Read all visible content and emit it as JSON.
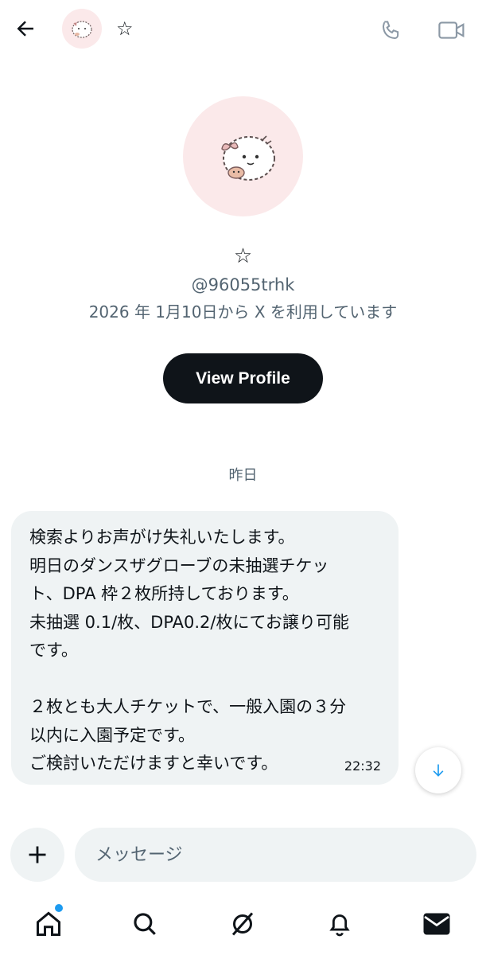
{
  "header": {
    "name": "☆",
    "back_icon": "arrow-left-icon",
    "call_icon": "phone-icon",
    "video_icon": "video-camera-icon"
  },
  "profile": {
    "name": "☆",
    "handle": "@96055trhk",
    "joined": "2026 年 1月10日から X を利用しています",
    "view_profile_label": "View Profile"
  },
  "conversation": {
    "date_label": "昨日",
    "messages": [
      {
        "text": "検索よりお声がけ失礼いたします。\n明日のダンスザグローブの未抽選チケッ\nト、DPA 枠２枚所持しております。\n未抽選 0.1/枚、DPA0.2/枚にてお譲り可能\nです。\n\n２枚とも大人チケットで、一般入園の３分\n以内に入園予定です。\nご検討いただけますと幸いです。",
        "time": "22:32"
      }
    ]
  },
  "composer": {
    "placeholder": "メッセージ",
    "add_icon": "plus-icon"
  },
  "bottom_nav": {
    "items": [
      "home-icon",
      "search-icon",
      "grok-icon",
      "notifications-icon",
      "messages-icon"
    ],
    "badge_color": "#1d9bf0"
  },
  "colors": {
    "text_primary": "#0f1419",
    "text_secondary": "#536471",
    "bubble_bg": "#eff3f4",
    "button_dark": "#0f1419",
    "avatar_bg": "#fbe9ea"
  }
}
